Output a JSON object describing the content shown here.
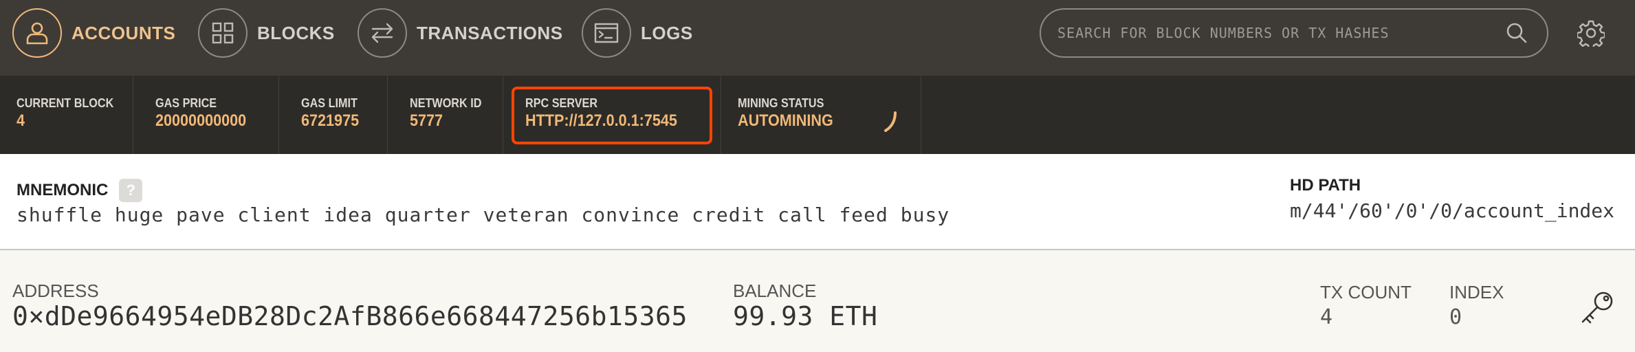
{
  "nav": {
    "items": [
      {
        "label": "ACCOUNTS",
        "icon": "user-icon",
        "active": true
      },
      {
        "label": "BLOCKS",
        "icon": "blocks-grid-icon",
        "active": false
      },
      {
        "label": "TRANSACTIONS",
        "icon": "swap-arrows-icon",
        "active": false
      },
      {
        "label": "LOGS",
        "icon": "terminal-icon",
        "active": false
      }
    ],
    "search_placeholder": "SEARCH FOR BLOCK NUMBERS OR TX HASHES",
    "search_icon": "search-icon",
    "settings_icon": "gear-icon"
  },
  "status": {
    "current_block": {
      "label": "CURRENT BLOCK",
      "value": "4"
    },
    "gas_price": {
      "label": "GAS PRICE",
      "value": "20000000000"
    },
    "gas_limit": {
      "label": "GAS LIMIT",
      "value": "6721975"
    },
    "network_id": {
      "label": "NETWORK ID",
      "value": "5777"
    },
    "rpc_server": {
      "label": "RPC SERVER",
      "value": "HTTP://127.0.0.1:7545"
    },
    "mining_status": {
      "label": "MINING STATUS",
      "value": "AUTOMINING"
    }
  },
  "mnemonic": {
    "title": "MNEMONIC",
    "help": "?",
    "words": "shuffle huge pave client idea quarter veteran convince credit call feed busy",
    "hd_path_title": "HD PATH",
    "hd_path": "m/44'/60'/0'/0/account_index"
  },
  "account": {
    "address_label": "ADDRESS",
    "address": "0×dDe9664954eDB28Dc2AfB866e668447256b15365",
    "balance_label": "BALANCE",
    "balance": "99.93 ETH",
    "tx_count_label": "TX COUNT",
    "tx_count": "4",
    "index_label": "INDEX",
    "index": "0"
  },
  "colors": {
    "nav_bg": "#3e3b37",
    "status_bg": "#2d2b27",
    "accent": "#f0b878",
    "highlight_border": "#ff4500"
  }
}
